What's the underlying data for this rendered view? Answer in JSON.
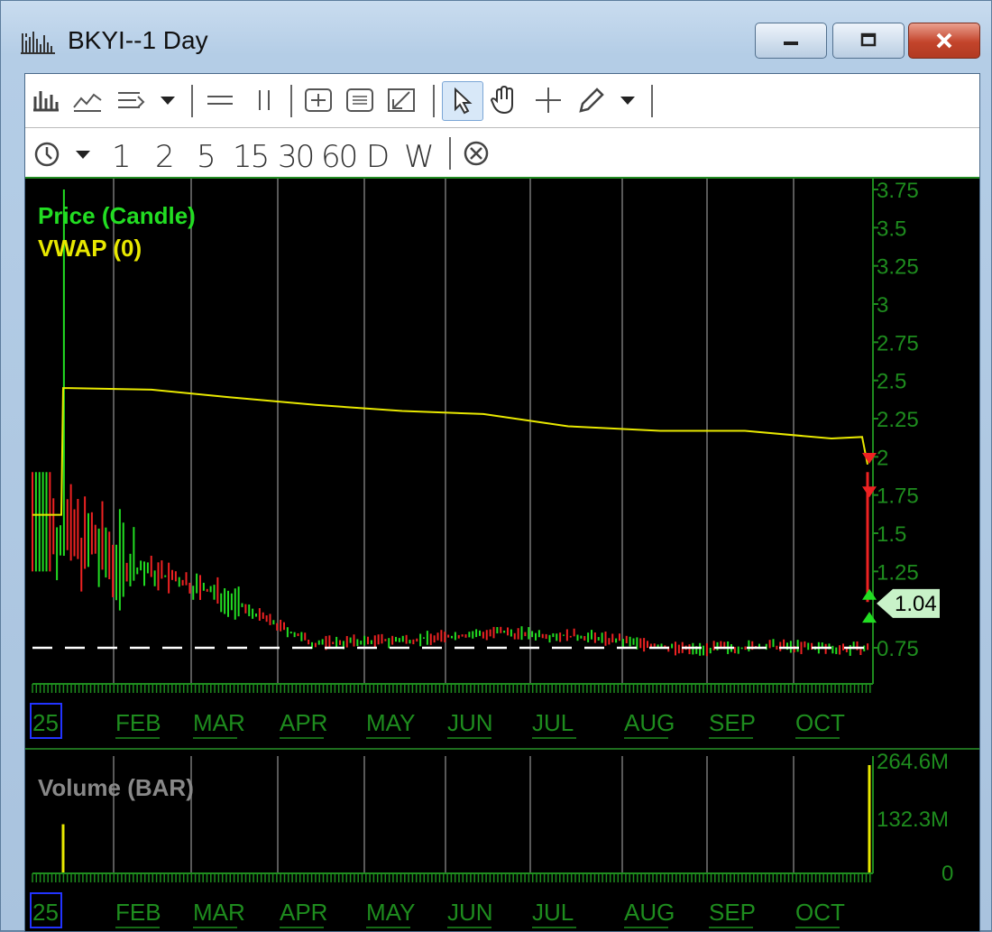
{
  "window": {
    "title": "BKYI--1 Day",
    "app_icon": "chart-bars-icon",
    "controls": [
      {
        "name": "minimize",
        "icon": "minimize-icon"
      },
      {
        "name": "maximize",
        "icon": "maximize-icon"
      },
      {
        "name": "close",
        "icon": "close-icon"
      }
    ]
  },
  "toolbar1": {
    "tools": [
      "chart-type-icon",
      "indicators-icon",
      "studies-icon",
      "dropdown-icon",
      "horizontal-line-icon",
      "vertical-line-icon",
      "zoom-in-icon",
      "zoom-out-icon",
      "fit-icon",
      "pointer-icon",
      "hand-icon",
      "crosshair-icon",
      "pencil-icon",
      "dropdown-icon"
    ]
  },
  "toolbar2": {
    "intervals": [
      "1",
      "2",
      "5",
      "15",
      "30",
      "60",
      "D",
      "W"
    ],
    "clock_icon": "clock-icon",
    "close_icon": "circle-x-icon"
  },
  "price_panel": {
    "legend": [
      {
        "label": "Price (Candle)",
        "color": "#22dd22"
      },
      {
        "label": "VWAP (0)",
        "color": "#e8e800"
      }
    ],
    "y_ticks": [
      "3.75",
      "3.5",
      "3.25",
      "3",
      "2.75",
      "2.5",
      "2.25",
      "2",
      "1.75",
      "1.5",
      "1.25",
      "0.75"
    ],
    "last_price": "1.04",
    "x_labels": [
      "25",
      "FEB",
      "MAR",
      "APR",
      "MAY",
      "JUN",
      "JUL",
      "AUG",
      "SEP",
      "OCT"
    ]
  },
  "volume_panel": {
    "legend": "Volume (BAR)",
    "y_ticks": [
      "264.6M",
      "132.3M",
      "0"
    ],
    "x_labels": [
      "25",
      "FEB",
      "MAR",
      "APR",
      "MAY",
      "JUN",
      "JUL",
      "AUG",
      "SEP",
      "OCT"
    ]
  },
  "chart_data": {
    "type": "line",
    "title": "BKYI--1 Day",
    "price_axis": {
      "ylim": [
        0.6,
        3.75
      ],
      "ticks": [
        3.75,
        3.5,
        3.25,
        3,
        2.75,
        2.5,
        2.25,
        2,
        1.75,
        1.5,
        1.25,
        0.75
      ]
    },
    "x_categories": [
      "25",
      "FEB",
      "MAR",
      "APR",
      "MAY",
      "JUN",
      "JUL",
      "AUG",
      "SEP",
      "OCT"
    ],
    "series": [
      {
        "name": "VWAP (0)",
        "color": "#e8e800",
        "x": [
          "25",
          "FEB",
          "MAR",
          "APR",
          "MAY",
          "JUN",
          "JUL",
          "AUG",
          "SEP",
          "OCT"
        ],
        "values": [
          2.45,
          2.44,
          2.39,
          2.34,
          2.3,
          2.28,
          2.2,
          2.17,
          2.17,
          2.12
        ]
      },
      {
        "name": "Price (Candle)",
        "color": "#22dd22",
        "x": [
          "25",
          "FEB",
          "MAR",
          "APR",
          "MAY",
          "JUN",
          "JUL",
          "AUG",
          "SEP",
          "OCT"
        ],
        "values": [
          1.6,
          1.3,
          1.1,
          0.78,
          0.8,
          0.85,
          0.82,
          0.74,
          0.76,
          0.74
        ]
      }
    ],
    "last_price": 1.04,
    "reference_line": 0.75,
    "volume": {
      "ylim": [
        0,
        264.6
      ],
      "unit": "M",
      "ticks": [
        "264.6M",
        "132.3M",
        "0"
      ],
      "spikes": [
        {
          "x": "25",
          "value": 120
        },
        {
          "x": "OCT",
          "value": 264.6
        }
      ]
    }
  }
}
